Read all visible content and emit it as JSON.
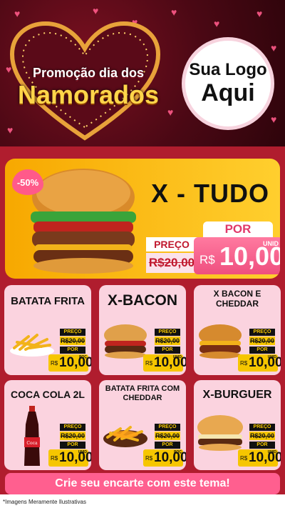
{
  "header": {
    "promo_line1": "Promoção dia dos",
    "promo_line2": "Namorados",
    "logo_line1": "Sua Logo",
    "logo_line2": "Aqui"
  },
  "featured": {
    "discount_badge": "-50%",
    "title": "X - TUDO",
    "preco_label": "PREÇO",
    "old_price": "R$20,00",
    "por_label": "POR",
    "currency": "R$",
    "new_price": "10,00",
    "unit": "UNID"
  },
  "products": [
    {
      "name": "BATATA FRITA",
      "preco_label": "PREÇO",
      "old_price": "R$20,00",
      "por_label": "POR",
      "currency": "R$",
      "new_price": "10,00",
      "unit": "POÇ"
    },
    {
      "name": "X-BACON",
      "preco_label": "PREÇO",
      "old_price": "R$20,00",
      "por_label": "POR",
      "currency": "R$",
      "new_price": "10,00",
      "unit": "UNID"
    },
    {
      "name": "X BACON E CHEDDAR",
      "preco_label": "PREÇO",
      "old_price": "R$20,00",
      "por_label": "POR",
      "currency": "R$",
      "new_price": "10,00",
      "unit": "UNID"
    },
    {
      "name": "COCA COLA 2L",
      "preco_label": "PREÇO",
      "old_price": "R$20,00",
      "por_label": "POR",
      "currency": "R$",
      "new_price": "10,00",
      "unit": "UNID"
    },
    {
      "name": "BATATA FRITA COM CHEDDAR",
      "preco_label": "PREÇO",
      "old_price": "R$20,00",
      "por_label": "POR",
      "currency": "R$",
      "new_price": "10,00",
      "unit": "POÇ"
    },
    {
      "name": "X-BURGUER",
      "preco_label": "PREÇO",
      "old_price": "R$20,00",
      "por_label": "POR",
      "currency": "R$",
      "new_price": "10,00",
      "unit": "UNID"
    }
  ],
  "cta": "Crie seu encarte com este tema!",
  "footnote": "*Imagens Meramente Ilustrativas",
  "colors": {
    "board": "#b01d2e",
    "card": "#fbd3df",
    "accent_pink": "#ff5f8f",
    "gold": "#f6c600"
  }
}
